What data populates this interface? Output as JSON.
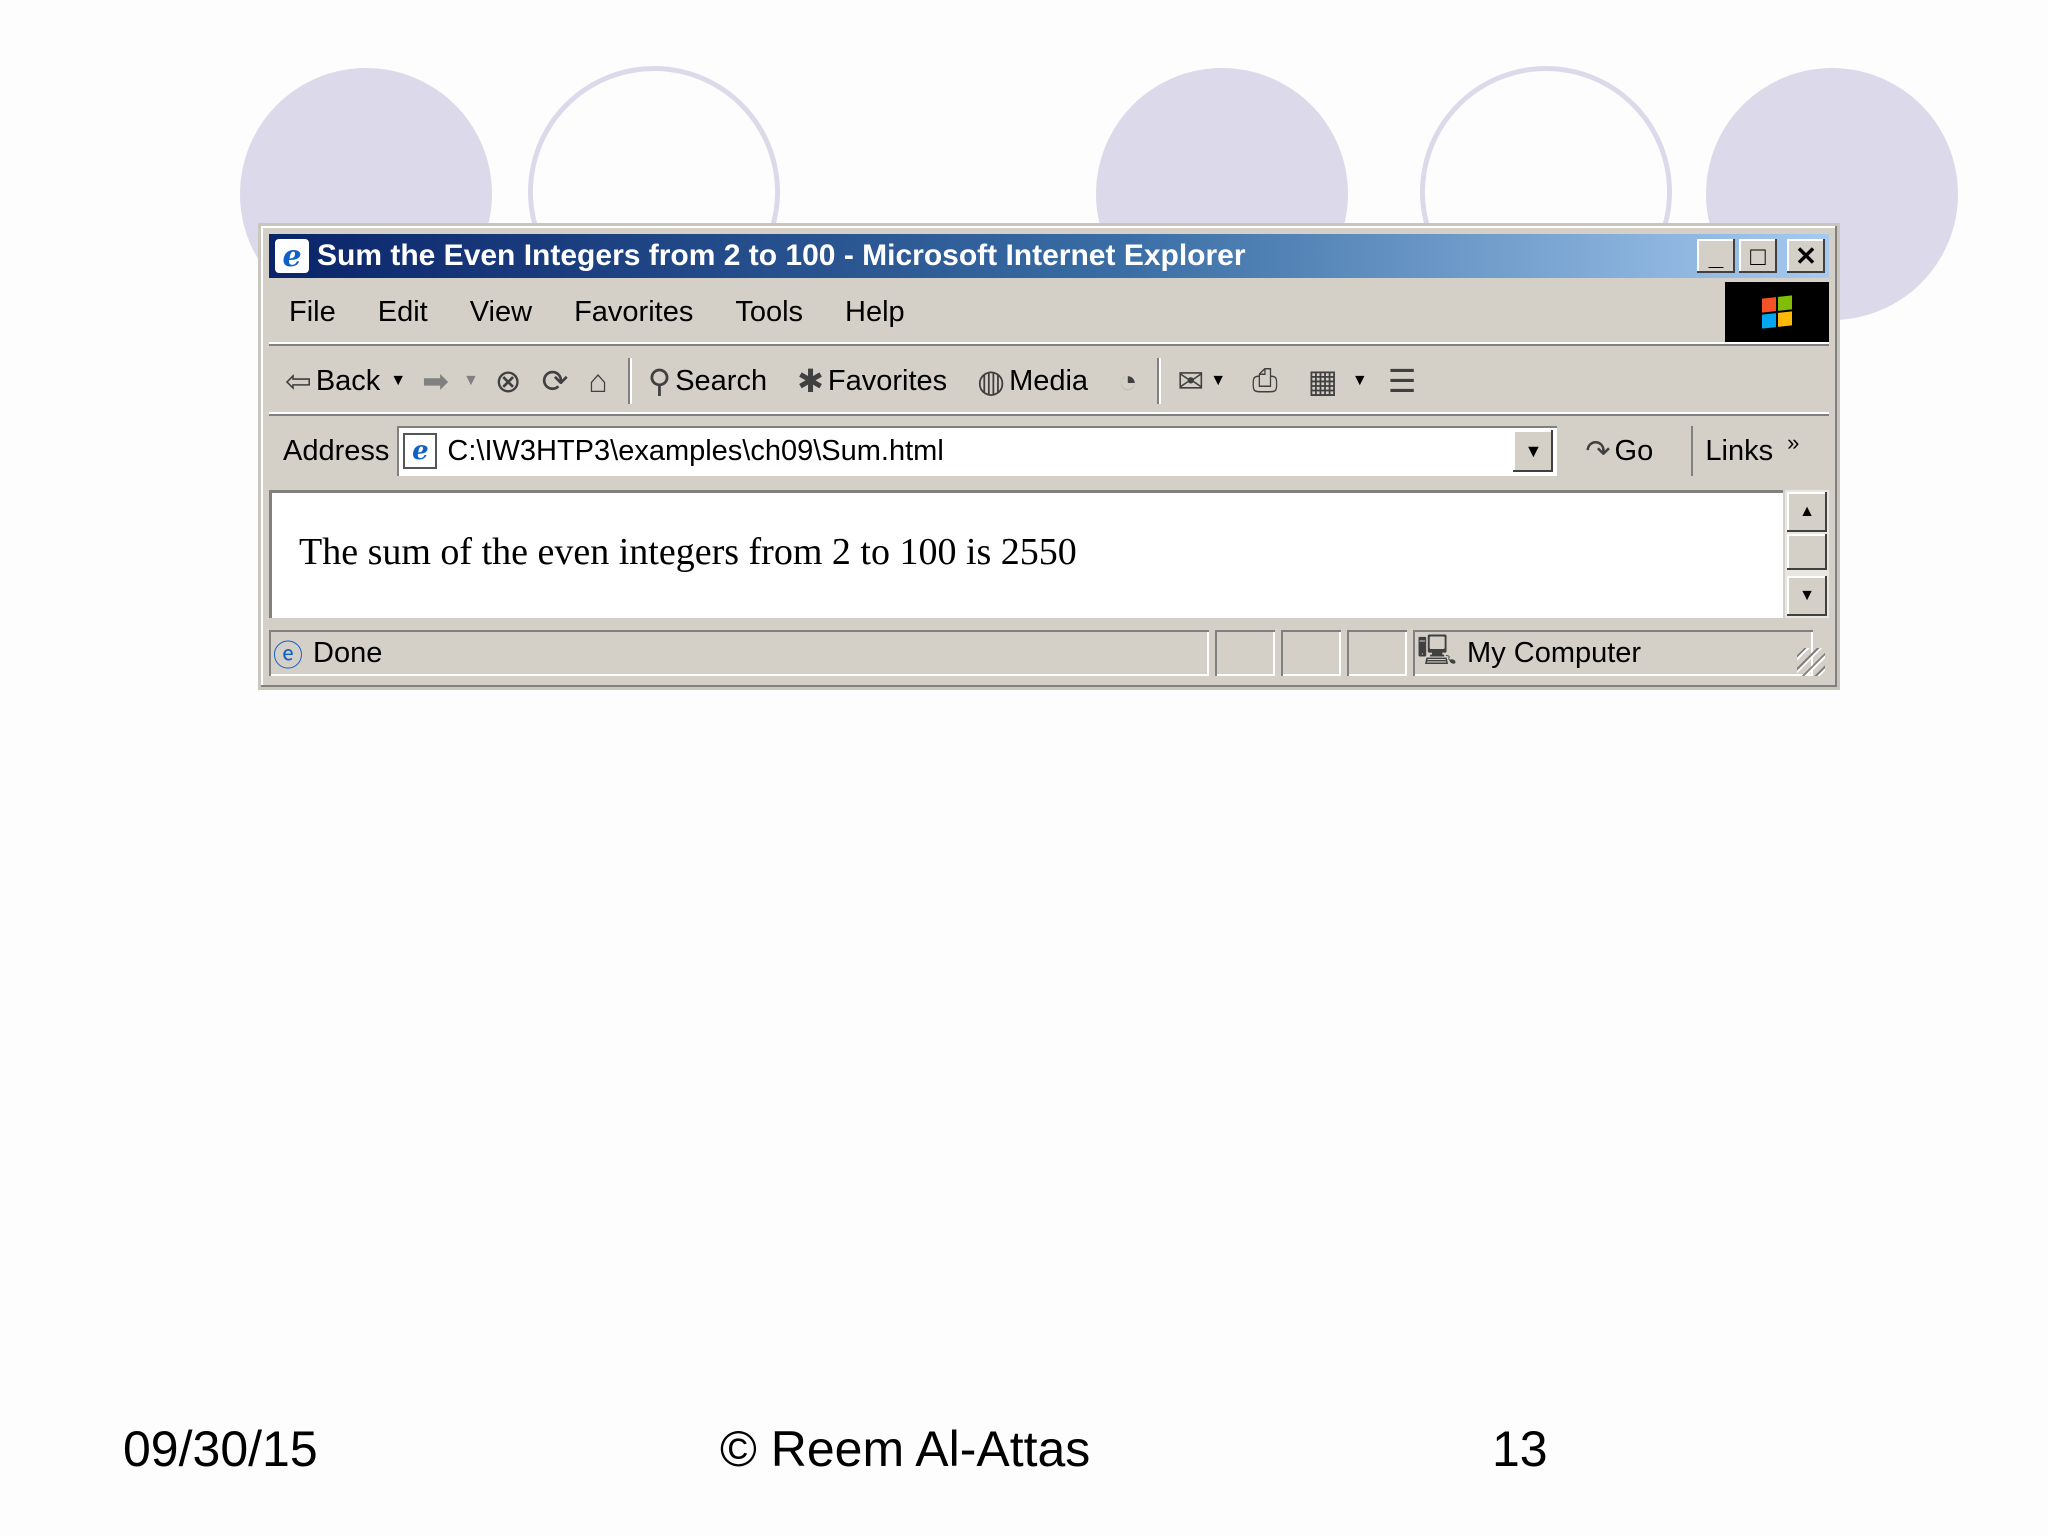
{
  "window": {
    "title": "Sum the Even Integers from 2 to 100 - Microsoft Internet Explorer",
    "controls": {
      "minimize": "_",
      "maximize": "□",
      "close": "✕"
    }
  },
  "menu": [
    "File",
    "Edit",
    "View",
    "Favorites",
    "Tools",
    "Help"
  ],
  "toolbar": {
    "back": "Back",
    "search": "Search",
    "favorites": "Favorites",
    "media": "Media",
    "icons": [
      "back-arrow-icon",
      "forward-arrow-icon",
      "stop-icon",
      "refresh-icon",
      "home-icon",
      "search-icon",
      "favorites-icon",
      "media-icon",
      "history-icon",
      "mail-icon",
      "print-icon",
      "edit-icon",
      "discuss-icon"
    ]
  },
  "address": {
    "label": "Address",
    "value": "C:\\IW3HTP3\\examples\\ch09\\Sum.html",
    "go": "Go",
    "links": "Links",
    "links_chevron": "»"
  },
  "page": {
    "text": "The sum of the even integers from 2 to 100 is 2550"
  },
  "status": {
    "text": "Done",
    "zone": "My Computer"
  },
  "slide_footer": {
    "date": "09/30/15",
    "author": "© Reem Al-Attas",
    "page_number": "13"
  },
  "colors": {
    "circle": "#dcdaea",
    "titlebar_start": "#0a246a",
    "titlebar_end": "#a6caf0",
    "chrome": "#d4d0c8"
  }
}
